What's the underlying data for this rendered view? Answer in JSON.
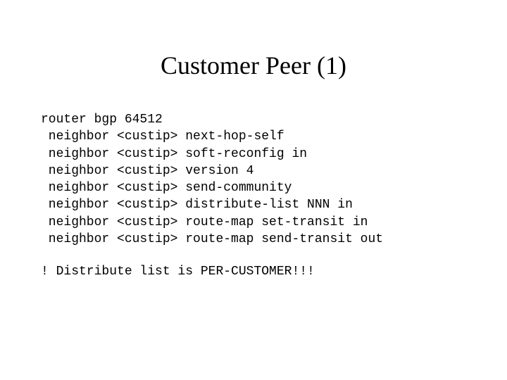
{
  "title": "Customer Peer (1)",
  "config": {
    "line0": "router bgp 64512",
    "line1": " neighbor <custip> next-hop-self",
    "line2": " neighbor <custip> soft-reconfig in",
    "line3": " neighbor <custip> version 4",
    "line4": " neighbor <custip> send-community",
    "line5": " neighbor <custip> distribute-list NNN in",
    "line6": " neighbor <custip> route-map set-transit in",
    "line7": " neighbor <custip> route-map send-transit out"
  },
  "note": "! Distribute list is PER-CUSTOMER!!!"
}
